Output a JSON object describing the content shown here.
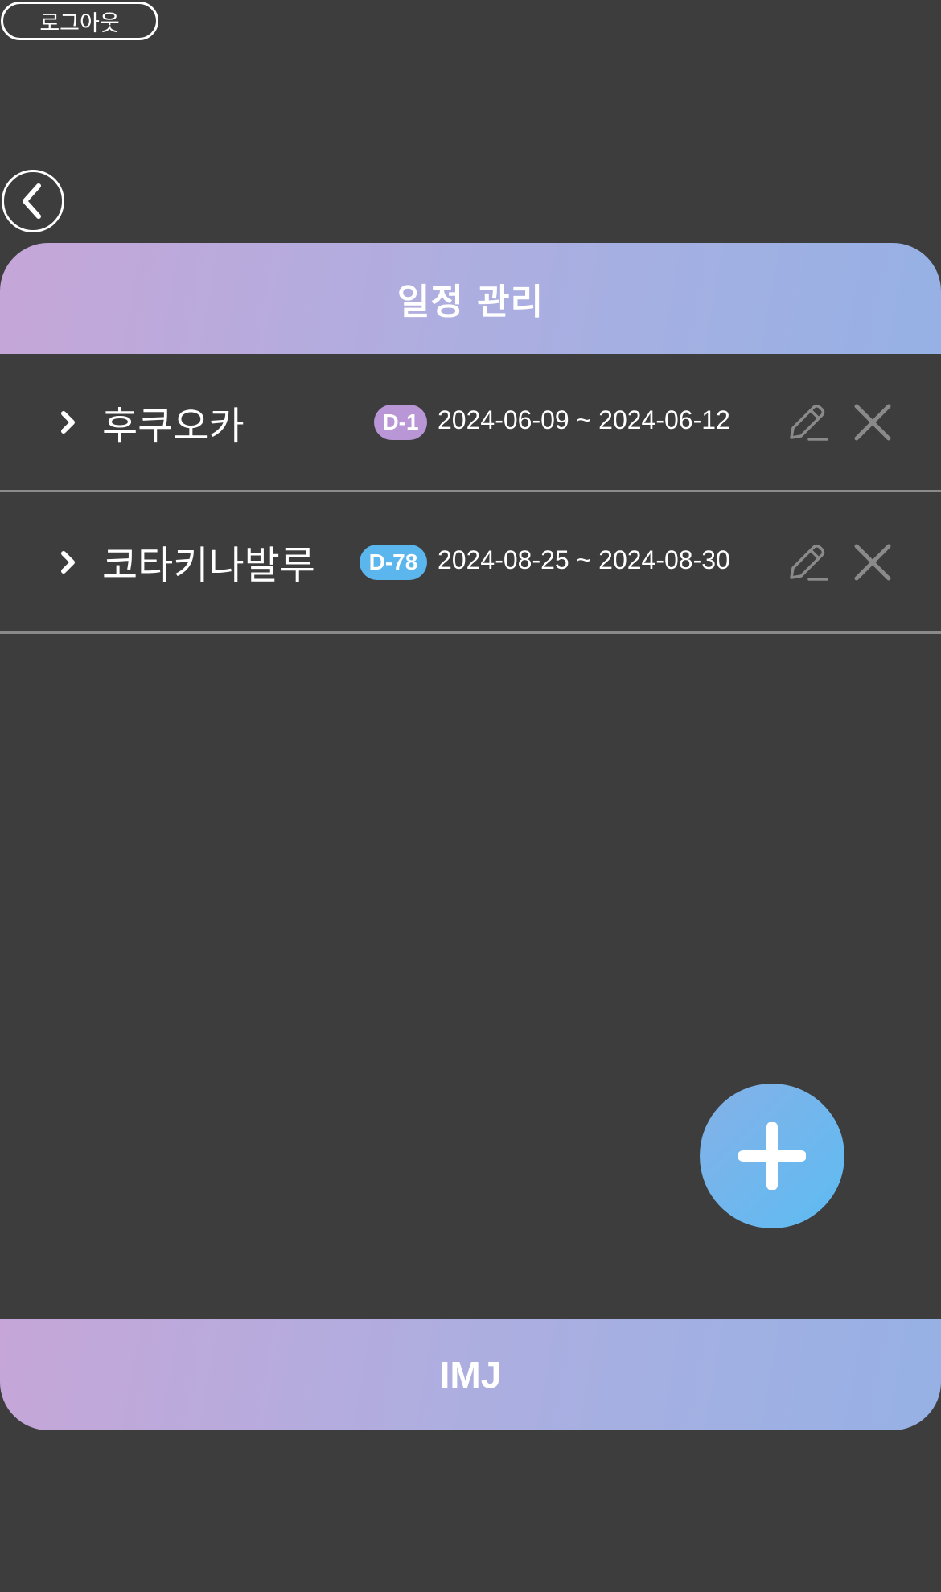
{
  "top": {
    "logout_label": "로그아웃"
  },
  "header": {
    "title": "일정 관리"
  },
  "trips": [
    {
      "name": "후쿠오카",
      "dday": "D-1",
      "dday_color": "#b996d6",
      "dates": "2024-06-09 ~ 2024-06-12"
    },
    {
      "name": "코타키나발루",
      "dday": "D-78",
      "dday_color": "#5cb6ee",
      "dates": "2024-08-25 ~ 2024-08-30"
    }
  ],
  "icons": {
    "back": "chevron-left-icon",
    "expand": "chevron-right-icon",
    "edit": "pencil-icon",
    "delete": "close-icon",
    "add": "plus-icon"
  },
  "footer": {
    "text": "IMJ"
  },
  "colors": {
    "background": "#3d3d3d",
    "gradient_start": "#c6a6d8",
    "gradient_end": "#96b1e5",
    "fab_start": "#85b1e8",
    "fab_end": "#5dbcf2"
  }
}
